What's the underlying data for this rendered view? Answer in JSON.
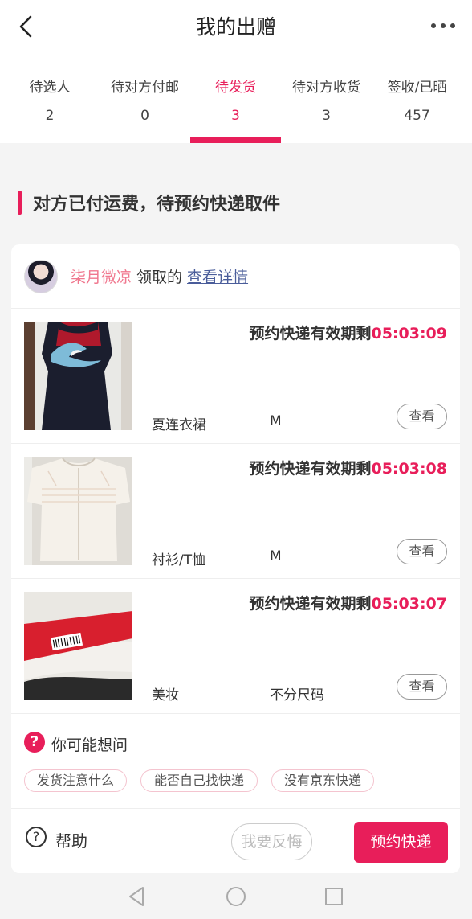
{
  "header": {
    "title": "我的出赠"
  },
  "tabs": [
    {
      "label": "待选人",
      "count": "2"
    },
    {
      "label": "待对方付邮",
      "count": "0"
    },
    {
      "label": "待发货",
      "count": "3"
    },
    {
      "label": "待对方收货",
      "count": "3"
    },
    {
      "label": "签收/已晒",
      "count": "457"
    }
  ],
  "section": {
    "title": "对方已付运费，待预约快递取件"
  },
  "giver": {
    "name": "柒月微凉",
    "middle": "领取的",
    "link": "查看详情"
  },
  "items": [
    {
      "deadline_label": "预约快递有效期剩",
      "countdown": "05:03:09",
      "category": "夏连衣裙",
      "size": "M",
      "view_label": "查看"
    },
    {
      "deadline_label": "预约快递有效期剩",
      "countdown": "05:03:08",
      "category": "衬衫/T恤",
      "size": "M",
      "view_label": "查看"
    },
    {
      "deadline_label": "预约快递有效期剩",
      "countdown": "05:03:07",
      "category": "美妆",
      "size": "不分尺码",
      "view_label": "查看"
    }
  ],
  "faq": {
    "title": "你可能想问",
    "chips": [
      "发货注意什么",
      "能否自己找快递",
      "没有京东快递"
    ]
  },
  "footer": {
    "help": "帮助",
    "regret": "我要反悔",
    "book": "预约快递"
  },
  "colors": {
    "accent": "#e81e5a",
    "link": "#4a5d9a",
    "name": "#f0788f"
  }
}
